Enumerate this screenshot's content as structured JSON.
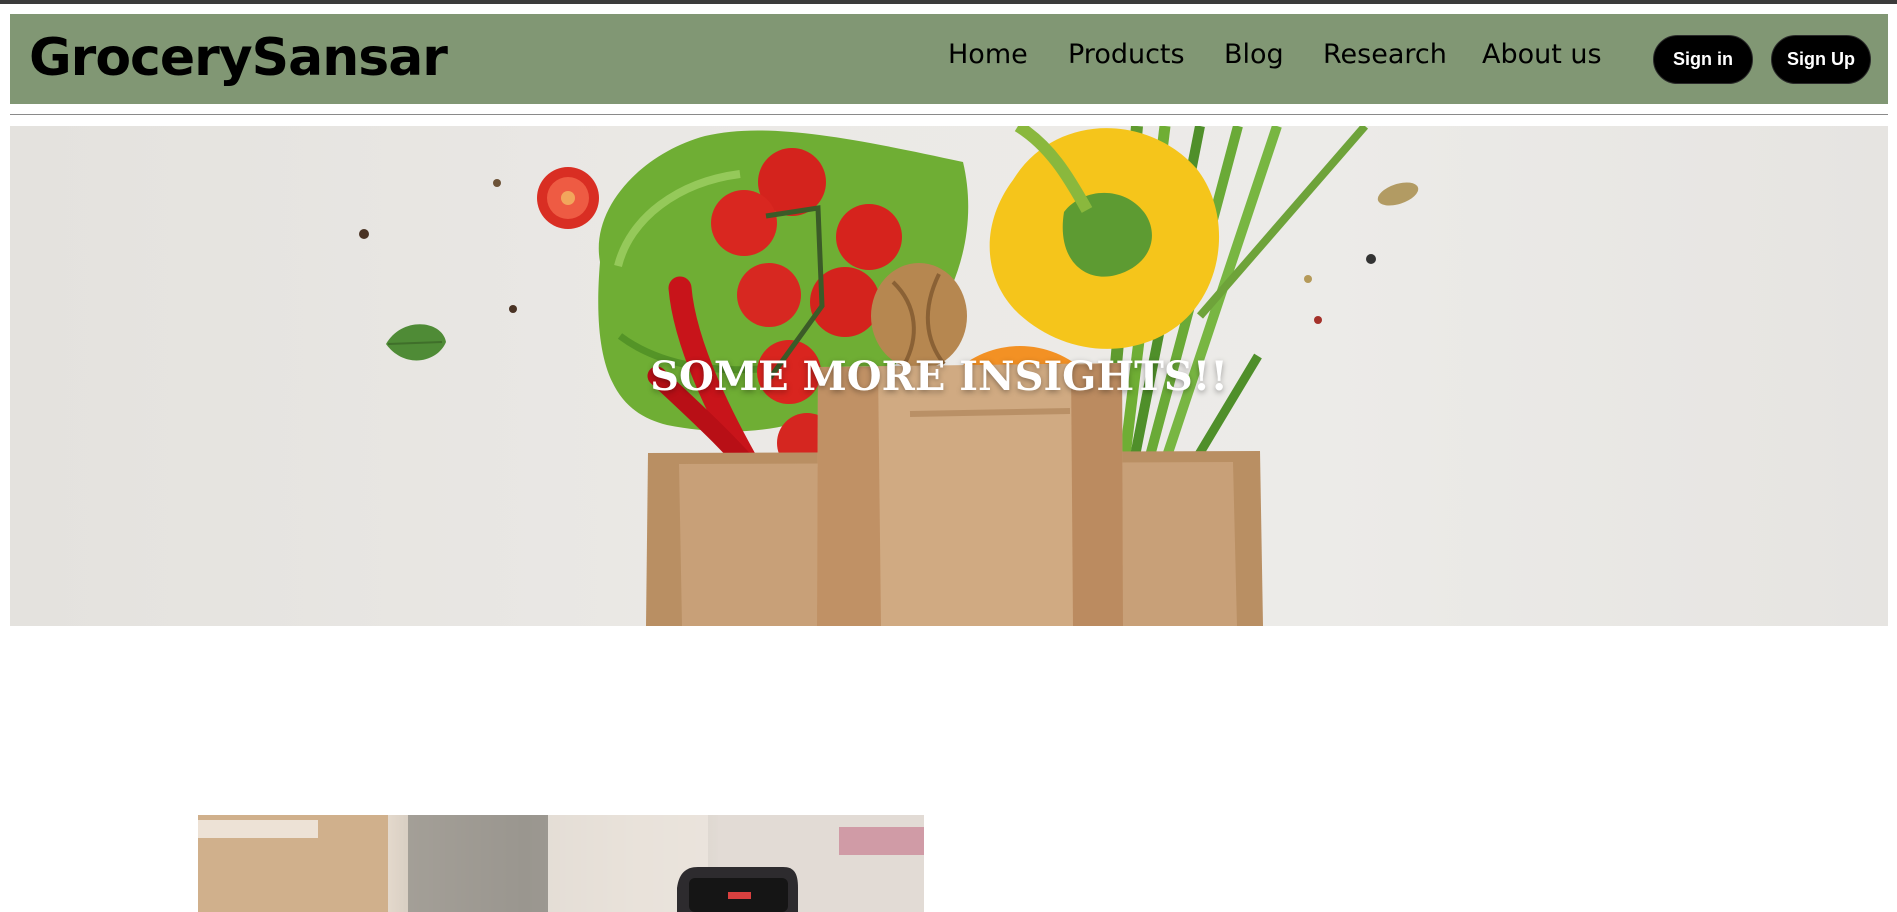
{
  "header": {
    "brand": "GrocerySansar",
    "nav": {
      "home": "Home",
      "products": "Products",
      "blog": "Blog",
      "research": "Research",
      "about": "About us"
    },
    "signin_label": "Sign in",
    "signup_label": "Sign Up"
  },
  "hero": {
    "title": "SOME MORE INSIGHTS!!"
  },
  "colors": {
    "navbar_background": "#819774",
    "button_background": "#000000",
    "button_text": "#ffffff",
    "hero_text": "#ffffff"
  },
  "icons": [
    "grocery-bag-photo",
    "shopper-phone-photo"
  ]
}
